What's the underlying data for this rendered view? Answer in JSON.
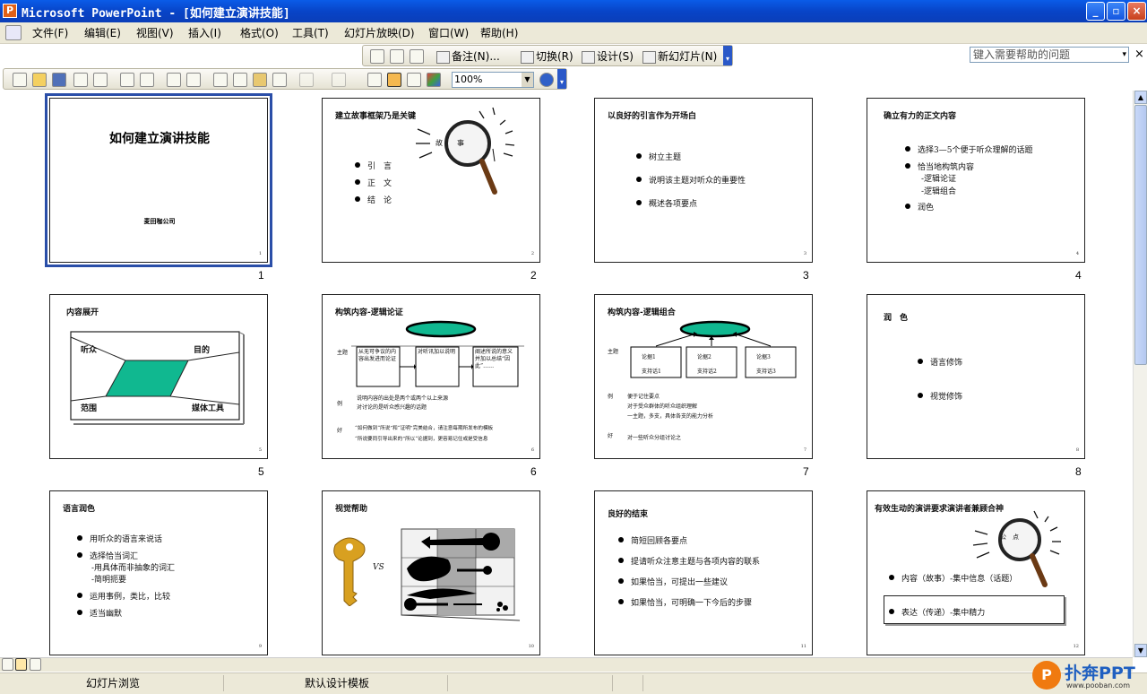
{
  "window": {
    "title": "Microsoft PowerPoint - [如何建立演讲技能]"
  },
  "menu": {
    "items": [
      "文件(F)",
      "编辑(E)",
      "视图(V)",
      "插入(I)",
      "格式(O)",
      "工具(T)",
      "幻灯片放映(D)",
      "窗口(W)",
      "帮助(H)"
    ],
    "help_placeholder": "键入需要帮助的问题"
  },
  "toolbar1": {
    "notes": "备注(N)...",
    "transition": "切换(R)",
    "design": "设计(S)",
    "new_slide": "新幻灯片(N)"
  },
  "toolbar2": {
    "zoom": "100%"
  },
  "slides": [
    {
      "num": "1",
      "title": "如何建立演讲技能",
      "company": "麦田咖公司",
      "pg": "1"
    },
    {
      "num": "2",
      "title": "建立故事框架乃是关键",
      "bullets": [
        "引　言",
        "正　文",
        "结　论"
      ],
      "mag": [
        "故",
        "事"
      ],
      "pg": "2"
    },
    {
      "num": "3",
      "title": "以良好的引言作为开场白",
      "bullets": [
        "树立主题",
        "说明该主题对听众的重要性",
        "概述各项要点"
      ],
      "pg": "3"
    },
    {
      "num": "4",
      "title": "确立有力的正文内容",
      "bullets": [
        "选择3—5个便于听众理解的话题",
        "恰当地构筑内容",
        "润色"
      ],
      "subs": [
        "-逻辑论证",
        "-逻辑组合"
      ],
      "pg": "4"
    },
    {
      "num": "5",
      "title": "内容展开",
      "labels": [
        "听众",
        "目的",
        "范围",
        "媒体工具"
      ],
      "pg": "5"
    },
    {
      "num": "6",
      "title": "构筑内容-逻辑论证",
      "row_labels": [
        "主题",
        "例",
        "好"
      ],
      "boxes": [
        "从无可争议的内容出发进而论证",
        "对听讯加以说明",
        "阐述所说的意义并加以总结“因此”……"
      ],
      "notes": [
        "说明内容的出处是两个或两个以上来源",
        "对讨论的是听众感兴趣的话题"
      ],
      "good": [
        "“如何做到“所说”和“证明”完美结合，请注意每期所发布的模板",
        "“所说要同引导出来的”所以“论据到，更容易记住或是受信息"
      ],
      "pg": "6"
    },
    {
      "num": "7",
      "title": "构筑内容-逻辑组合",
      "row_labels": [
        "主题",
        "例",
        "好"
      ],
      "boxes": [
        {
          "a": "论据1",
          "b": "支持话1"
        },
        {
          "a": "论据2",
          "b": "支持话2"
        },
        {
          "a": "论据3",
          "b": "支持话3"
        }
      ],
      "notes": [
        "便于记住要点",
        "对于受众群体的听众组织理解",
        "一主题，多支，具体各支的能力分析"
      ],
      "good": [
        "对一些听众分组讨论之"
      ],
      "pg": "7"
    },
    {
      "num": "8",
      "title": "润　色",
      "bullets": [
        "语言修饰",
        "视觉修饰"
      ],
      "pg": "8"
    },
    {
      "num": "9",
      "title": "语言润色",
      "bullets": [
        "用听众的语言来说话",
        "选择恰当词汇",
        "运用事例，类比，比较",
        "适当幽默"
      ],
      "subs": [
        "-用具体而非抽象的词汇",
        "-简明扼要"
      ],
      "pg": "9"
    },
    {
      "num": "10",
      "title": "视觉帮助",
      "vs": "VS",
      "pg": "10"
    },
    {
      "num": "11",
      "title": "良好的结束",
      "bullets": [
        "简短回顾各要点",
        "提请听众注意主题与各项内容的联系",
        "如果恰当，可提出一些建议",
        "如果恰当，可明确一下今后的步骤"
      ],
      "pg": "11"
    },
    {
      "num": "12",
      "title": "有效生动的演讲要求演讲者兼顾合神",
      "bullets": [
        "内容（故事）-集中信息（话题）",
        "表达（传递）-集中精力"
      ],
      "mag": [
        "公",
        "点"
      ],
      "pg": "12"
    }
  ],
  "status": {
    "view": "幻灯片浏览",
    "template": "默认设计模板"
  },
  "watermark": {
    "logo": "P",
    "name": "扑奔PPT",
    "url": "www.pooban.com"
  }
}
